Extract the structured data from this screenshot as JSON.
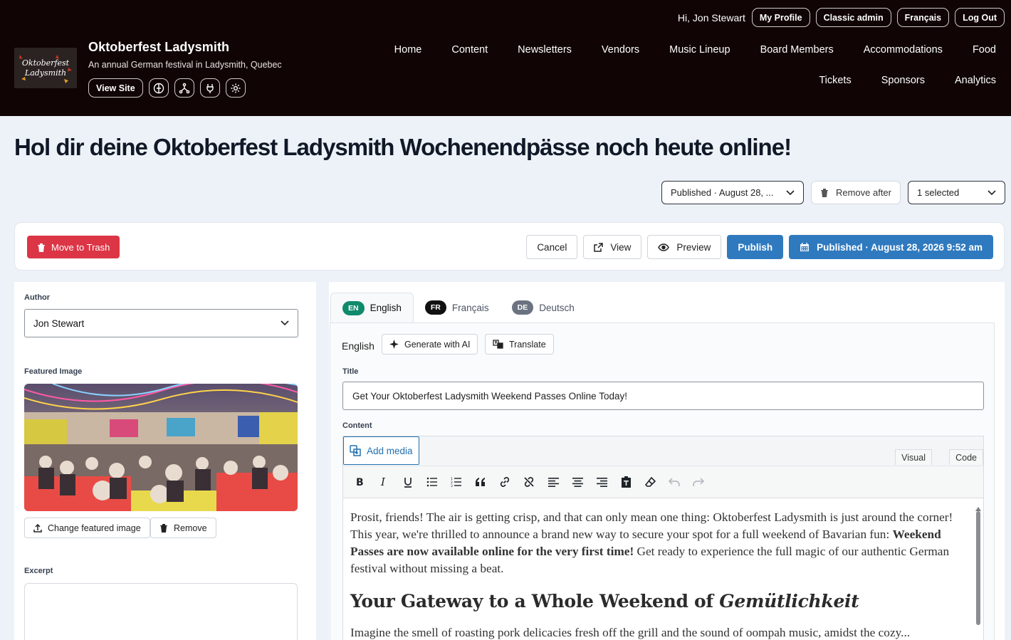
{
  "site": {
    "title": "Oktoberfest Ladysmith",
    "subtitle": "An annual German festival in Ladysmith, Quebec",
    "view_site": "View Site",
    "logo_text": "Oktoberfest Ladysmith"
  },
  "user": {
    "greeting": "Hi, Jon Stewart",
    "my_profile": "My Profile",
    "classic_admin": "Classic admin",
    "language": "Français",
    "log_out": "Log Out"
  },
  "nav": {
    "row1": [
      "Home",
      "Content",
      "Newsletters",
      "Vendors",
      "Music Lineup",
      "Board Members",
      "Accommodations",
      "Food"
    ],
    "row2": [
      "Tickets",
      "Sponsors",
      "Analytics"
    ]
  },
  "page": {
    "heading": "Hol dir deine Oktoberfest Ladysmith Wochenendpässe noch heute online!"
  },
  "status": {
    "published": "Published · August 28, ...",
    "remove_after": "Remove after",
    "categories": "1 selected"
  },
  "actions": {
    "trash": "Move to Trash",
    "cancel": "Cancel",
    "view": "View",
    "preview": "Preview",
    "publish": "Publish",
    "published_at": "Published · August 28, 2026 9:52 am"
  },
  "sidebar": {
    "author_label": "Author",
    "author_value": "Jon Stewart",
    "featured_label": "Featured Image",
    "change_image": "Change featured image",
    "remove_image": "Remove",
    "excerpt_label": "Excerpt"
  },
  "tabs": [
    {
      "code": "EN",
      "label": "English",
      "color": "#0f8a6b"
    },
    {
      "code": "FR",
      "label": "Français",
      "color": "#111111"
    },
    {
      "code": "DE",
      "label": "Deutsch",
      "color": "#6b7280"
    }
  ],
  "editor": {
    "language": "English",
    "generate_ai": "Generate with AI",
    "translate": "Translate",
    "title_label": "Title",
    "title_value": "Get Your Oktoberfest Ladysmith Weekend Passes Online Today!",
    "content_label": "Content",
    "add_media": "Add media",
    "visual": "Visual",
    "code": "Code",
    "body_p1_a": "Prosit, friends! The air is getting crisp, and that can only mean one thing: Oktoberfest Ladysmith is just around the corner! This year, we're thrilled to announce a brand new way to secure your spot for a full weekend of Bavarian fun: ",
    "body_p1_bold": "Weekend Passes are now available online for the very first time!",
    "body_p1_b": " Get ready to experience the full magic of our authentic German festival without missing a beat.",
    "body_h2_a": "Your Gateway to a Whole Weekend of ",
    "body_h2_em": "Gemütlichkeit",
    "body_p2": "Imagine the smell of roasting pork delicacies fresh off the grill and the sound of oompah music, amidst the cozy..."
  },
  "colors": {
    "header_bg": "#100404",
    "primary": "#2f7abf",
    "danger": "#dc3545",
    "link": "#2271b1"
  }
}
